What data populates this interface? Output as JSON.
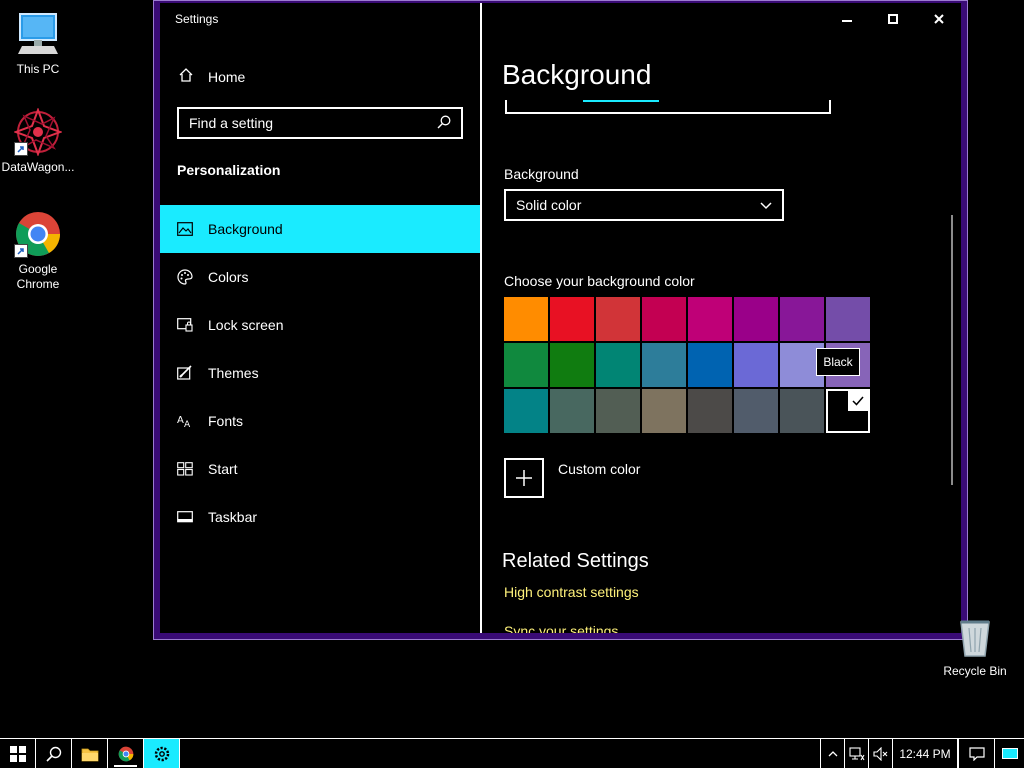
{
  "desktop": {
    "icons": [
      {
        "label": "This PC",
        "icon": "computer-icon"
      },
      {
        "label": "DataWagon...",
        "icon": "datawagon-app-icon"
      },
      {
        "label": "Google Chrome",
        "icon": "chrome-icon"
      }
    ],
    "recycle_bin": {
      "label": "Recycle Bin",
      "icon": "recycle-bin-icon"
    }
  },
  "window": {
    "title": "Settings",
    "controls": [
      "minimize",
      "maximize",
      "close"
    ]
  },
  "sidebar": {
    "home_label": "Home",
    "search": {
      "placeholder": "Find a setting"
    },
    "section_title": "Personalization",
    "items": [
      {
        "label": "Background",
        "icon": "picture-icon",
        "active": true
      },
      {
        "label": "Colors",
        "icon": "palette-icon",
        "active": false
      },
      {
        "label": "Lock screen",
        "icon": "lock-screen-icon",
        "active": false
      },
      {
        "label": "Themes",
        "icon": "themes-icon",
        "active": false
      },
      {
        "label": "Fonts",
        "icon": "fonts-icon",
        "active": false
      },
      {
        "label": "Start",
        "icon": "start-icon",
        "active": false
      },
      {
        "label": "Taskbar",
        "icon": "taskbar-icon",
        "active": false
      }
    ]
  },
  "main": {
    "title": "Background",
    "background_label": "Background",
    "background_value": "Solid color",
    "choose_color_label": "Choose your background color",
    "swatches": [
      "#ff8c00",
      "#e81123",
      "#d13438",
      "#c30052",
      "#bf0077",
      "#9a0089",
      "#881798",
      "#744da9",
      "#10893e",
      "#107c10",
      "#018574",
      "#2d7d9a",
      "#0063b1",
      "#6b69d6",
      "#8e8cd8",
      "#8764b8",
      "#038387",
      "#486860",
      "#525e54",
      "#7e735f",
      "#4c4a48",
      "#515c6b",
      "#4a5459",
      "#000000"
    ],
    "selected_swatch_index": 23,
    "tooltip": "Black",
    "custom_color_label": "Custom color",
    "related_title": "Related Settings",
    "links": [
      "High contrast settings",
      "Sync your settings"
    ]
  },
  "taskbar": {
    "clock": "12:44 PM",
    "apps": [
      "start-icon",
      "search-icon",
      "file-explorer-icon",
      "chrome-icon",
      "settings-icon"
    ]
  },
  "colors": {
    "accent": "#1aebff",
    "link": "#fff27b",
    "window_border": "#3a0b76"
  }
}
